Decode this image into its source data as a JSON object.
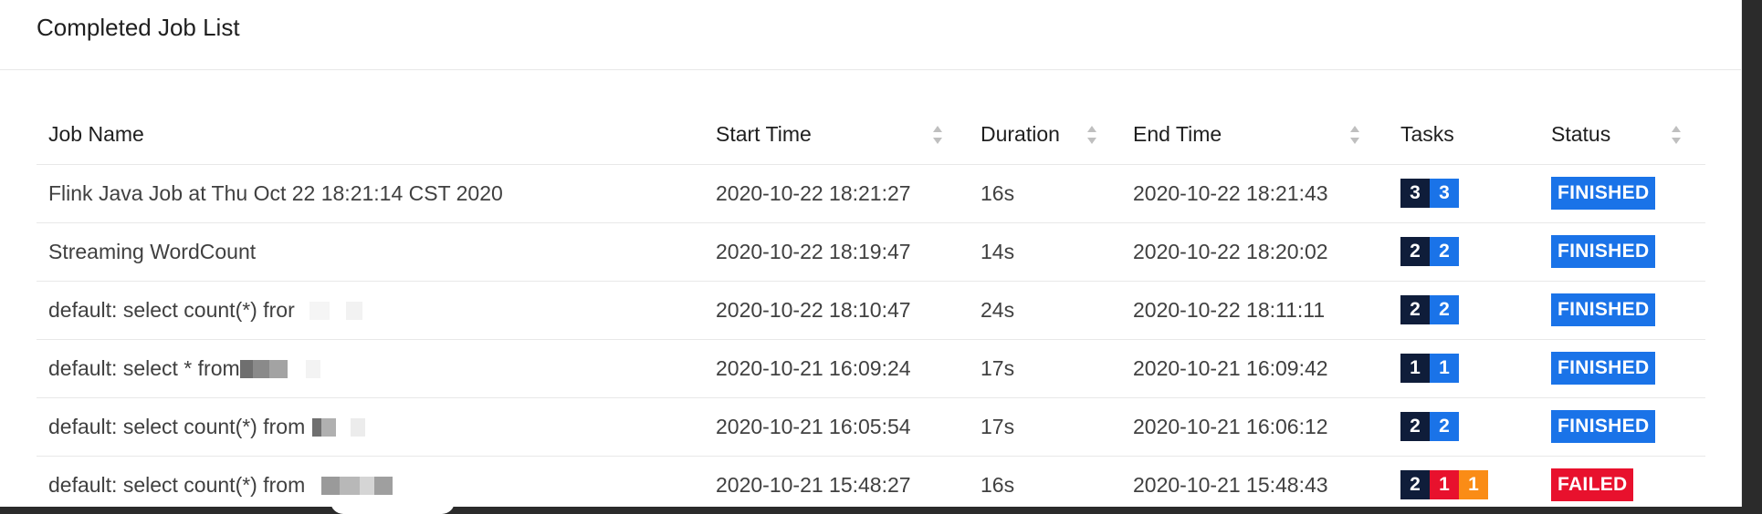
{
  "card": {
    "title": "Completed Job List"
  },
  "columns": [
    {
      "key": "name",
      "label": "Job Name",
      "sortable": false
    },
    {
      "key": "start",
      "label": "Start Time",
      "sortable": true
    },
    {
      "key": "duration",
      "label": "Duration",
      "sortable": true
    },
    {
      "key": "end",
      "label": "End Time",
      "sortable": true
    },
    {
      "key": "tasks",
      "label": "Tasks",
      "sortable": false
    },
    {
      "key": "status",
      "label": "Status",
      "sortable": true
    }
  ],
  "colors": {
    "task_dark": "#0f1d3a",
    "task_blue": "#1a73e8",
    "task_red": "#e8112d",
    "task_orange": "#fa8c16",
    "status_finished": "#1a73e8",
    "status_failed": "#e8112d"
  },
  "rows": [
    {
      "name": "Flink Java Job at Thu Oct 22 18:21:14 CST 2020",
      "start": "2020-10-22 18:21:27",
      "duration": "16s",
      "end": "2020-10-22 18:21:43",
      "tasks": [
        {
          "value": "3",
          "kind": "task_dark"
        },
        {
          "value": "3",
          "kind": "task_blue"
        }
      ],
      "status": "FINISHED",
      "status_kind": "status_finished"
    },
    {
      "name": "Streaming WordCount",
      "start": "2020-10-22 18:19:47",
      "duration": "14s",
      "end": "2020-10-22 18:20:02",
      "tasks": [
        {
          "value": "2",
          "kind": "task_dark"
        },
        {
          "value": "2",
          "kind": "task_blue"
        }
      ],
      "status": "FINISHED",
      "status_kind": "status_finished"
    },
    {
      "name": "default: select count(*) fror",
      "start": "2020-10-22 18:10:47",
      "duration": "24s",
      "end": "2020-10-22 18:11:11",
      "tasks": [
        {
          "value": "2",
          "kind": "task_dark"
        },
        {
          "value": "2",
          "kind": "task_blue"
        }
      ],
      "status": "FINISHED",
      "status_kind": "status_finished"
    },
    {
      "name": "default: select * from",
      "start": "2020-10-21 16:09:24",
      "duration": "17s",
      "end": "2020-10-21 16:09:42",
      "tasks": [
        {
          "value": "1",
          "kind": "task_dark"
        },
        {
          "value": "1",
          "kind": "task_blue"
        }
      ],
      "status": "FINISHED",
      "status_kind": "status_finished"
    },
    {
      "name": "default: select count(*) from",
      "start": "2020-10-21 16:05:54",
      "duration": "17s",
      "end": "2020-10-21 16:06:12",
      "tasks": [
        {
          "value": "2",
          "kind": "task_dark"
        },
        {
          "value": "2",
          "kind": "task_blue"
        }
      ],
      "status": "FINISHED",
      "status_kind": "status_finished"
    },
    {
      "name": "default: select count(*) from",
      "start": "2020-10-21 15:48:27",
      "duration": "16s",
      "end": "2020-10-21 15:48:43",
      "tasks": [
        {
          "value": "2",
          "kind": "task_dark"
        },
        {
          "value": "1",
          "kind": "task_red"
        },
        {
          "value": "1",
          "kind": "task_orange"
        }
      ],
      "status": "FAILED",
      "status_kind": "status_failed"
    }
  ]
}
